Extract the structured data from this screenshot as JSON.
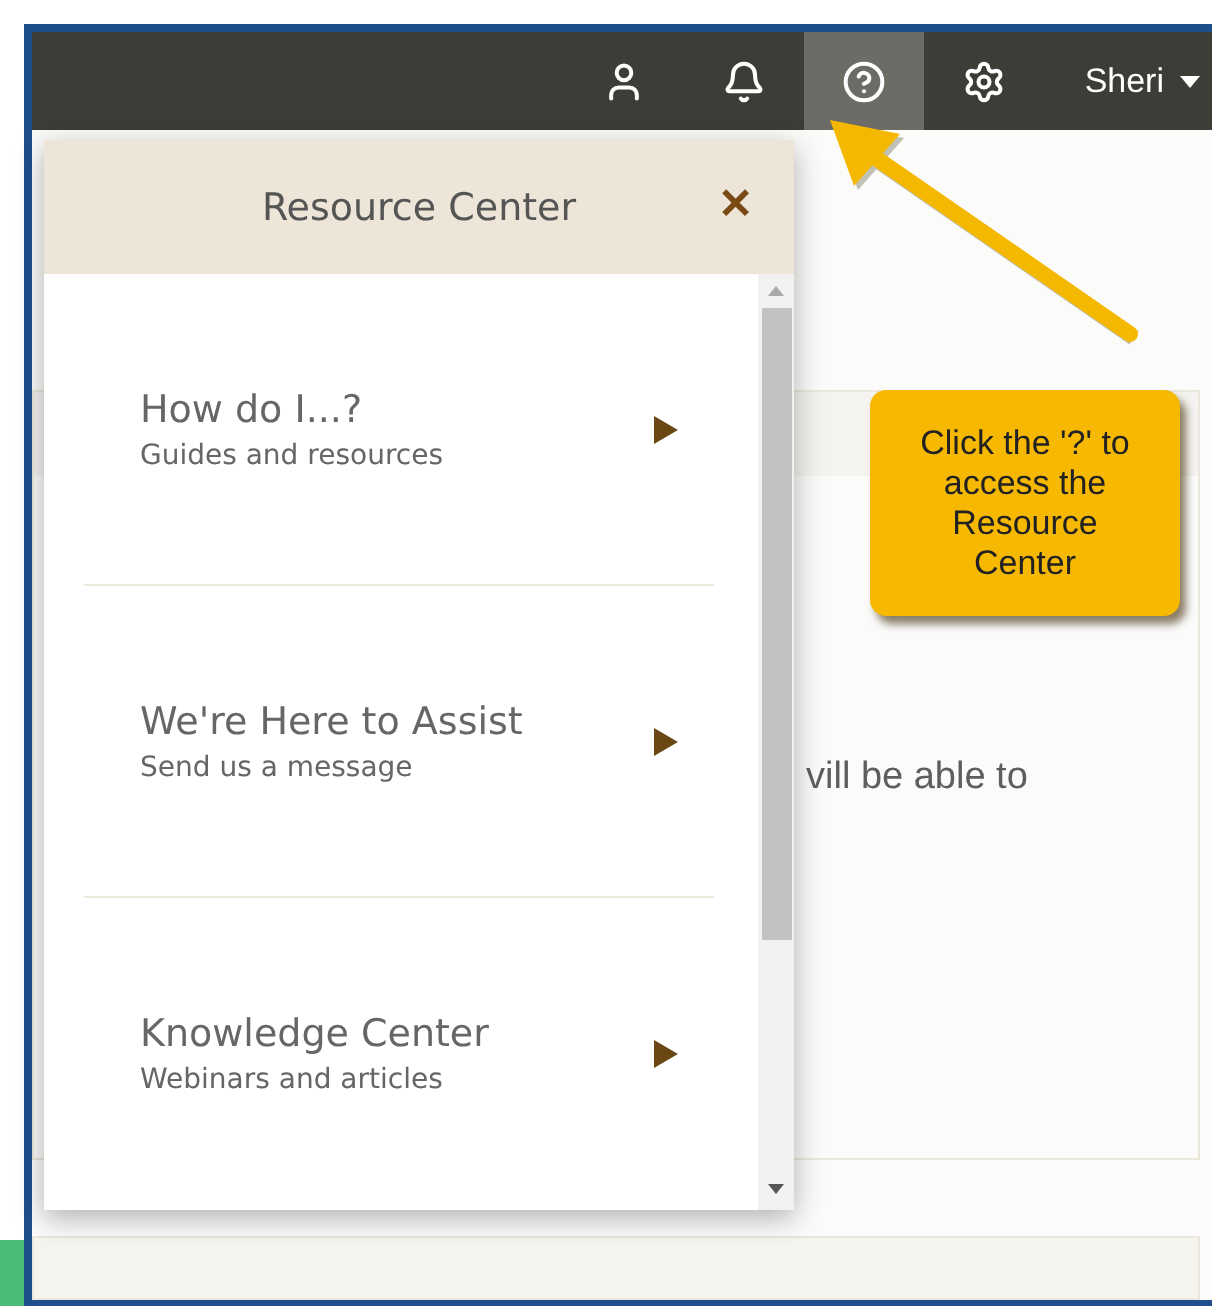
{
  "top_bar": {
    "icons": [
      {
        "kind": "user",
        "selected": false
      },
      {
        "kind": "bell",
        "selected": false
      },
      {
        "kind": "help",
        "selected": true
      },
      {
        "kind": "settings",
        "selected": false
      }
    ],
    "user_menu": "Sheri"
  },
  "page": {
    "body_text": "vill be able to"
  },
  "resource_center": {
    "title": "Resource Center",
    "close": "✕",
    "items": [
      {
        "title": "How do I...?",
        "subtitle": "Guides and resources"
      },
      {
        "title": "We're Here to Assist",
        "subtitle": "Send us a message"
      },
      {
        "title": "Knowledge Center",
        "subtitle": "Webinars and articles"
      }
    ]
  },
  "callout": {
    "text": "Click the '?' to access the Resource Center"
  }
}
